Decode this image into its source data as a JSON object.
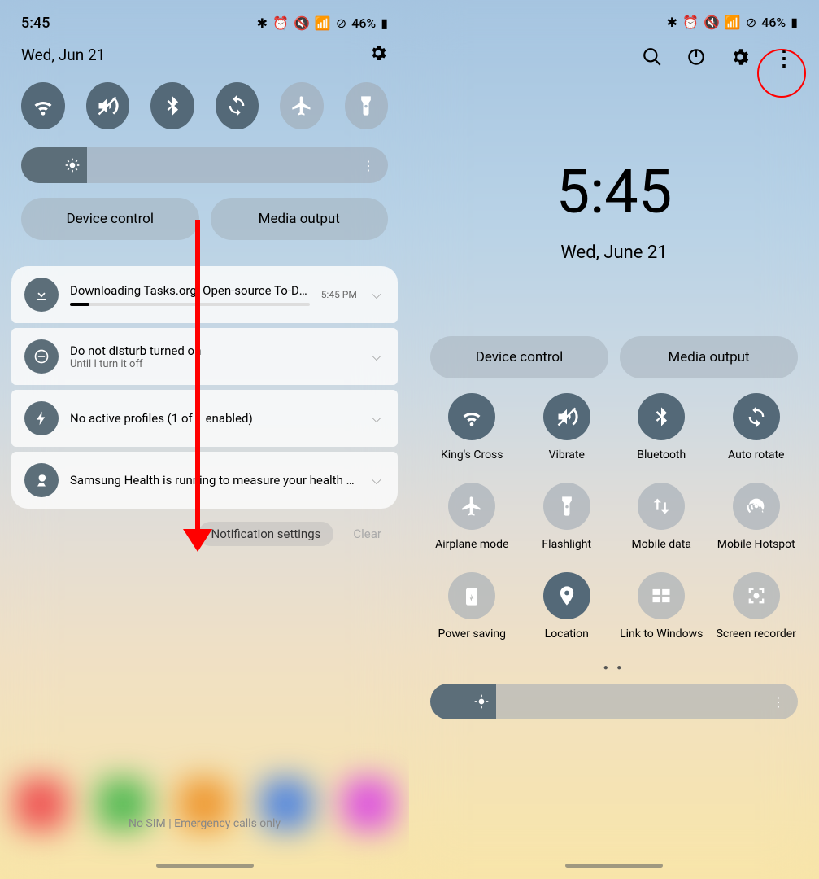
{
  "status": {
    "time": "5:45",
    "battery_text": "46%",
    "icons": [
      "bluetooth",
      "alarm",
      "mute",
      "wifi",
      "no-circle"
    ]
  },
  "left": {
    "date": "Wed, Jun 21",
    "quick_toggles": [
      {
        "name": "wifi",
        "active": true
      },
      {
        "name": "mute",
        "active": true
      },
      {
        "name": "bluetooth",
        "active": true
      },
      {
        "name": "auto-rotate",
        "active": true
      },
      {
        "name": "airplane",
        "active": false
      },
      {
        "name": "flashlight",
        "active": false
      }
    ],
    "brightness_pct": 18,
    "device_control": "Device control",
    "media_output": "Media output",
    "notifications": [
      {
        "icon": "download",
        "title": "Downloading Tasks.org: Open-source To-Do Lists &…",
        "time": "5:45 PM",
        "progress": 8
      },
      {
        "icon": "dnd",
        "title": "Do not disturb turned on",
        "sub": "Until I turn it off"
      },
      {
        "icon": "bolt",
        "title": "No active profiles (1 of 1 enabled)"
      },
      {
        "icon": "health",
        "title": "Samsung Health is running to measure your health data."
      }
    ],
    "notif_settings": "Notification settings",
    "clear": "Clear",
    "footer": "No SIM | Emergency calls only"
  },
  "right": {
    "big_time": "5:45",
    "big_date": "Wed, June 21",
    "device_control": "Device control",
    "media_output": "Media output",
    "brightness_pct": 18,
    "tiles": [
      {
        "name": "wifi",
        "label": "King's Cross",
        "active": true
      },
      {
        "name": "mute",
        "label": "Vibrate",
        "active": true
      },
      {
        "name": "bluetooth",
        "label": "Bluetooth",
        "active": true
      },
      {
        "name": "auto-rotate",
        "label": "Auto rotate",
        "active": true
      },
      {
        "name": "airplane",
        "label": "Airplane mode",
        "active": false
      },
      {
        "name": "flashlight",
        "label": "Flashlight",
        "active": false
      },
      {
        "name": "mobile-data",
        "label": "Mobile data",
        "active": false
      },
      {
        "name": "hotspot",
        "label": "Mobile Hotspot",
        "active": false
      },
      {
        "name": "power-saving",
        "label": "Power saving",
        "active": false
      },
      {
        "name": "location",
        "label": "Location",
        "active": true
      },
      {
        "name": "link-windows",
        "label": "Link to Windows",
        "active": false
      },
      {
        "name": "screen-recorder",
        "label": "Screen recorder",
        "active": false
      }
    ]
  }
}
